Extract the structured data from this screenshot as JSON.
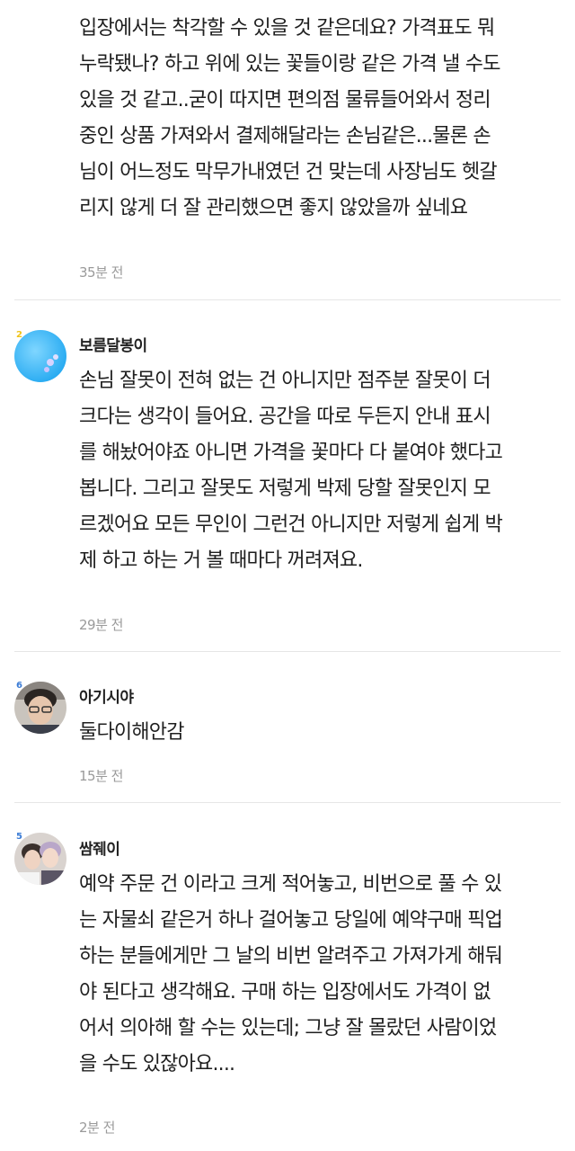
{
  "comments": [
    {
      "author": "",
      "lines": [
        "입장에서는 착각할 수 있을 것 같은데요? 가격표도 뭐",
        "누락됐나? 하고 위에 있는 꽃들이랑 같은 가격 낼 수도",
        "있을 것 같고..굳이 따지면 편의점 물류들어와서 정리",
        "중인 상품 가져와서 결제해달라는 손님같은...물론 손",
        "님이 어느정도 막무가내였던 건 맞는데 사장님도 헷갈",
        "리지 않게 더 잘 관리했으면 좋지 않았을까 싶네요"
      ],
      "time": "35분 전"
    },
    {
      "author": "보름달봉이",
      "level": "2",
      "level_color": "#f0c419",
      "avatar_icon": "blue-bubble-avatar",
      "lines": [
        "손님 잘못이 전혀 없는 건 아니지만 점주분 잘못이 더",
        "크다는 생각이 들어요. 공간을 따로 두든지 안내 표시",
        "를 해놨어야죠 아니면 가격을 꽃마다 다 붙여야 했다고",
        "봅니다. 그리고 잘못도 저렇게 박제 당할 잘못인지 모",
        "르겠어요 모든 무인이 그런건 아니지만 저렇게 쉽게 박",
        "제 하고 하는 거 볼 때마다 꺼려져요."
      ],
      "time": "29분 전"
    },
    {
      "author": "아기시야",
      "level": "6",
      "level_color": "#3a7bd5",
      "avatar_icon": "person-photo-avatar",
      "lines": [
        "둘다이해안감"
      ],
      "time": "15분 전"
    },
    {
      "author": "쌈줴이",
      "level": "5",
      "level_color": "#3a7bd5",
      "avatar_icon": "duo-photo-avatar",
      "lines": [
        "예약 주문 건 이라고 크게 적어놓고, 비번으로 풀 수 있",
        "는 자물쇠 같은거 하나 걸어놓고 당일에 예약구매 픽업",
        "하는 분들에게만 그 날의 비번 알려주고 가져가게 해둬",
        "야 된다고 생각해요. 구매 하는 입장에서도 가격이 없",
        "어서 의아해 할 수는 있는데; 그냥 잘 몰랐던 사람이었",
        "을 수도 있잖아요...."
      ],
      "time": "2분 전"
    }
  ]
}
